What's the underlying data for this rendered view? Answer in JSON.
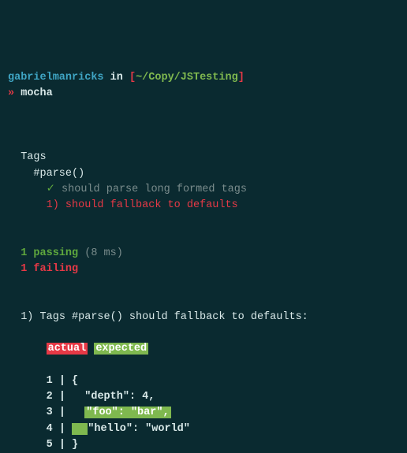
{
  "prompt": {
    "user": "gabrielmanricks",
    "in": "in",
    "bracket_open": "[",
    "path": "~/Copy/JSTesting",
    "bracket_close": "]",
    "arrow": "»",
    "cmd": "mocha"
  },
  "suite": {
    "name": "Tags",
    "describe": "#parse()",
    "tests": [
      {
        "mark": "✓",
        "text": "should parse long formed tags"
      },
      {
        "mark": "1)",
        "text": "should fallback to defaults"
      }
    ]
  },
  "summary": {
    "passing_count": "1",
    "passing_label": "passing",
    "passing_time": "(8 ms)",
    "failing_count": "1",
    "failing_label": "failing"
  },
  "failure": {
    "index": "1)",
    "title": "Tags #parse() should fallback to defaults:",
    "legend_actual": "actual",
    "legend_expected": "expected",
    "diff": [
      {
        "n": "1",
        "plain": "{"
      },
      {
        "n": "2",
        "plain": "  \"depth\": 4,"
      },
      {
        "n": "3",
        "lead": "  ",
        "hl": "\"foo\": \"bar\",",
        "hlclass": "expected"
      },
      {
        "n": "4",
        "hl_lead": "  ",
        "post": "\"hello\": \"world\"",
        "hlclass": "expected"
      },
      {
        "n": "5",
        "plain": "}"
      }
    ]
  }
}
